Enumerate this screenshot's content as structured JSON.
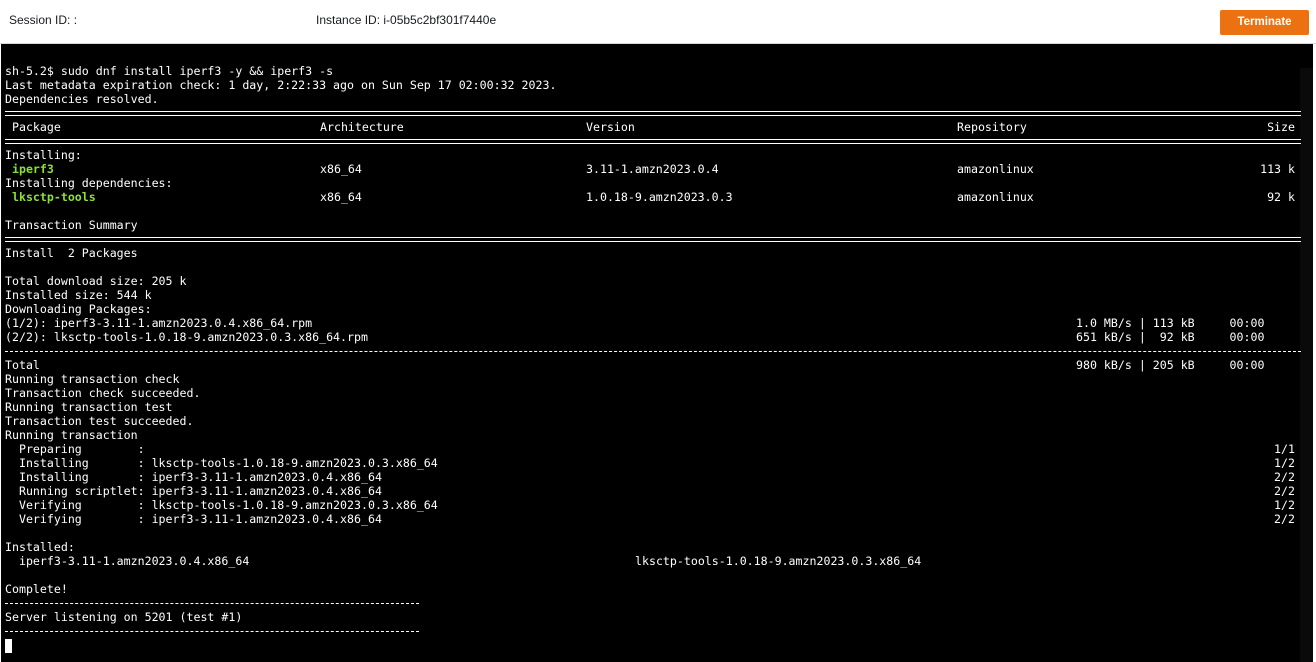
{
  "header": {
    "session_label": "Session ID: :",
    "instance_label": "Instance ID: i-05b5c2bf301f7440e",
    "terminate_label": "Terminate"
  },
  "terminal": {
    "prompt_cmd": "sh-5.2$ sudo dnf install iperf3 -y && iperf3 -s",
    "meta": "Last metadata expiration check: 1 day, 2:22:33 ago on Sun Sep 17 02:00:32 2023.",
    "deps_resolved": "Dependencies resolved.",
    "columns": {
      "package": " Package",
      "arch": "Architecture",
      "version": "Version",
      "repo": "Repository",
      "size": "Size"
    },
    "installing_label": "Installing:",
    "installing_deps_label": "Installing dependencies:",
    "packages": [
      {
        "name": " iperf3",
        "arch": "x86_64",
        "version": "3.11-1.amzn2023.0.4",
        "repo": "amazonlinux",
        "size": "113 k"
      },
      {
        "name": " lksctp-tools",
        "arch": "x86_64",
        "version": "1.0.18-9.amzn2023.0.3",
        "repo": "amazonlinux",
        "size": "92 k"
      }
    ],
    "transaction_summary": "Transaction Summary",
    "install_count": "Install  2 Packages",
    "total_download": "Total download size: 205 k",
    "installed_size": "Installed size: 544 k",
    "downloading": "Downloading Packages:",
    "downloads": [
      {
        "name": "(1/2): iperf3-3.11-1.amzn2023.0.4.x86_64.rpm",
        "rate": "1.0 MB/s | 113 kB     00:00"
      },
      {
        "name": "(2/2): lksctp-tools-1.0.18-9.amzn2023.0.3.x86_64.rpm",
        "rate": "651 kB/s |  92 kB     00:00"
      }
    ],
    "total_label": "Total",
    "total_rate": "980 kB/s | 205 kB     00:00",
    "tx_lines": [
      "Running transaction check",
      "Transaction check succeeded.",
      "Running transaction test",
      "Transaction test succeeded.",
      "Running transaction"
    ],
    "steps": [
      {
        "text": "  Preparing        :",
        "count": "1/1"
      },
      {
        "text": "  Installing       : lksctp-tools-1.0.18-9.amzn2023.0.3.x86_64",
        "count": "1/2"
      },
      {
        "text": "  Installing       : iperf3-3.11-1.amzn2023.0.4.x86_64",
        "count": "2/2"
      },
      {
        "text": "  Running scriptlet: iperf3-3.11-1.amzn2023.0.4.x86_64",
        "count": "2/2"
      },
      {
        "text": "  Verifying        : lksctp-tools-1.0.18-9.amzn2023.0.3.x86_64",
        "count": "1/2"
      },
      {
        "text": "  Verifying        : iperf3-3.11-1.amzn2023.0.4.x86_64",
        "count": "2/2"
      }
    ],
    "installed_label": "Installed:",
    "installed_pkgs": [
      "  iperf3-3.11-1.amzn2023.0.4.x86_64",
      "lksctp-tools-1.0.18-9.amzn2023.0.3.x86_64"
    ],
    "complete": "Complete!",
    "server_listening": "Server listening on 5201 (test #1)"
  }
}
